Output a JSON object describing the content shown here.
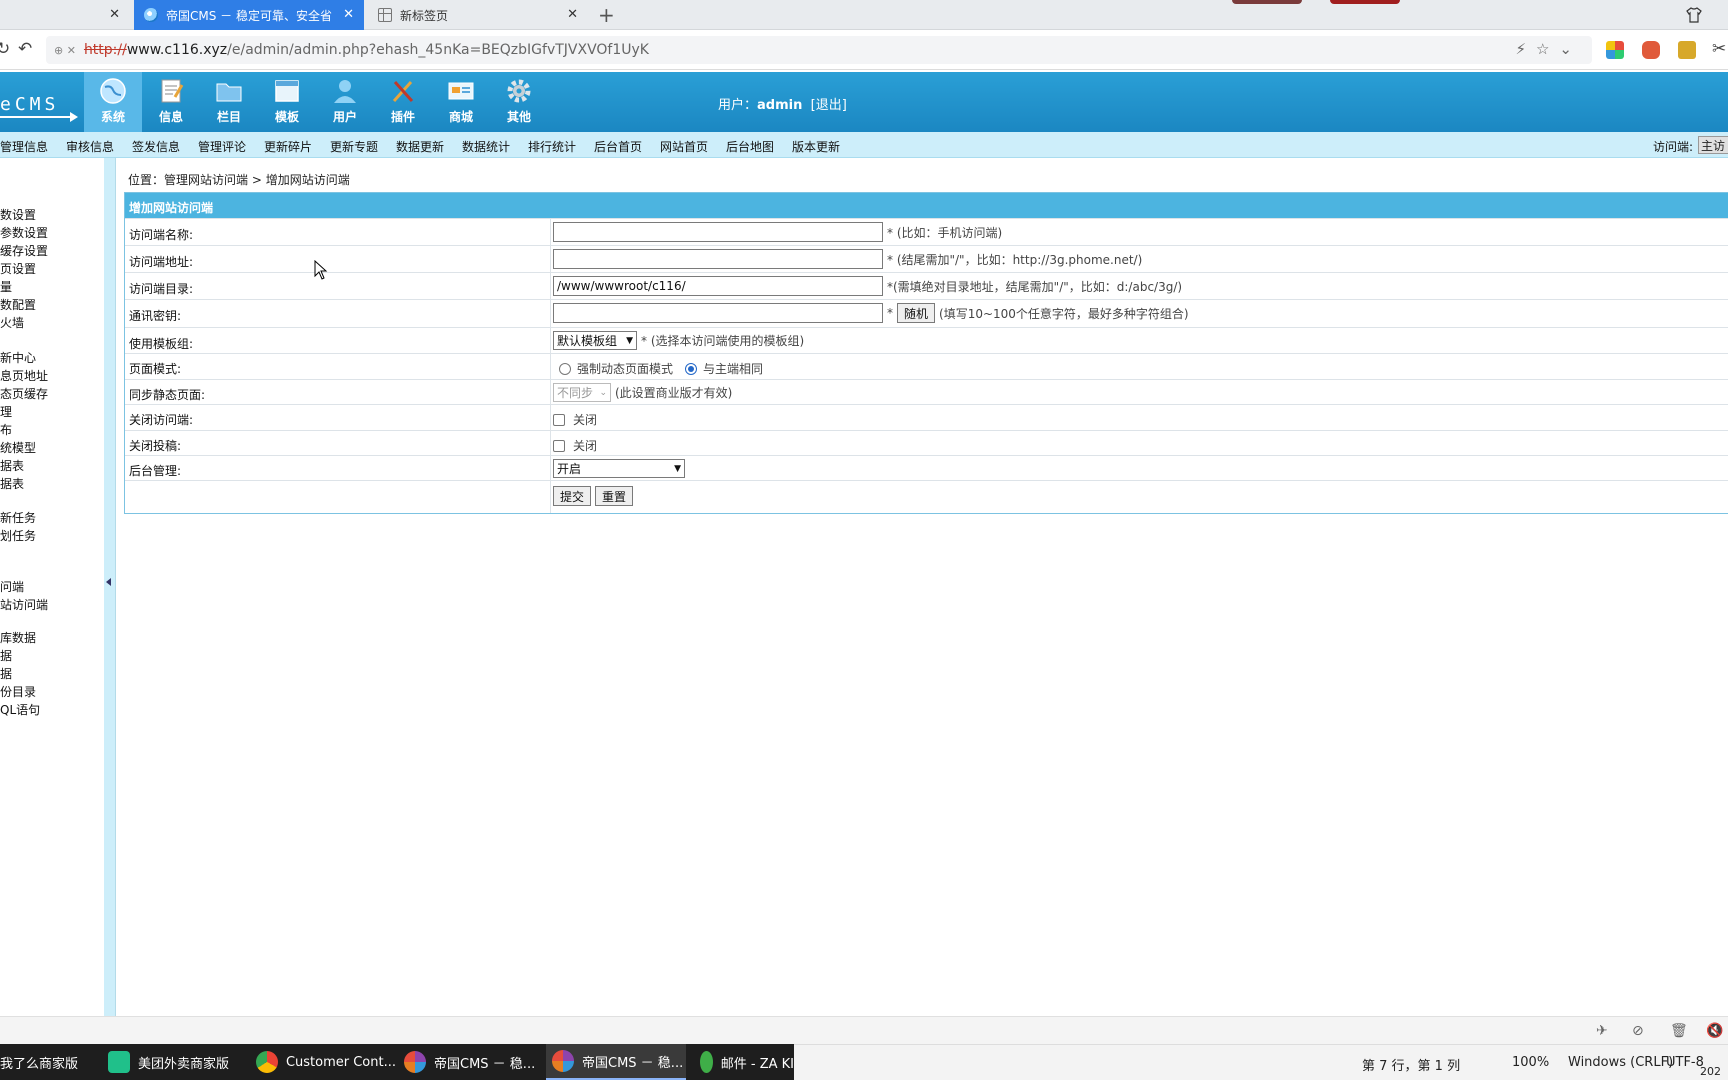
{
  "browser": {
    "tabs": [
      {
        "label": ""
      },
      {
        "label": "帝国CMS － 稳定可靠、安全省"
      },
      {
        "label": "新标签页"
      }
    ],
    "url_scheme": "http://",
    "url_host": "www.c116.xyz",
    "url_path": "/e/admin/admin.php?ehash_45nKa=BEQzbIGfvTJVXVOf1UyK"
  },
  "header": {
    "logo": "eCMS",
    "menu": [
      "系统",
      "信息",
      "栏目",
      "模板",
      "用户",
      "插件",
      "商城",
      "其他"
    ],
    "user_label": "用户：",
    "user_name": "admin",
    "logout": "[退出]"
  },
  "subnav": {
    "items": [
      "管理信息",
      "审核信息",
      "签发信息",
      "管理评论",
      "更新碎片",
      "更新专题",
      "数据更新",
      "数据统计",
      "排行统计",
      "后台首页",
      "网站首页",
      "后台地图",
      "版本更新"
    ],
    "target_label": "访问端:",
    "target_value": "主访"
  },
  "sidebar": {
    "items": [
      "数设置",
      "参数设置",
      "缓存设置",
      "页设置",
      "量",
      "数配置",
      "火墙",
      "新中心",
      "息页地址",
      "态页缓存",
      "理",
      "布",
      "统模型",
      "据表",
      "据表",
      "新任务",
      "划任务",
      "问端",
      "站访问端",
      "库数据",
      "据",
      "据",
      "份目录",
      "QL语句"
    ]
  },
  "breadcrumb": {
    "prefix": "位置：",
    "link": "管理网站访问端",
    "sep": " > ",
    "current": "增加网站访问端"
  },
  "form": {
    "title": "增加网站访问端",
    "name_label": "访问端名称:",
    "name_hint": "* (比如：手机访问端)",
    "url_label": "访问端地址:",
    "url_hint": "* (结尾需加\"/\"，比如：http://3g.phome.net/)",
    "dir_label": "访问端目录:",
    "dir_value": "/www/wwwroot/c116/",
    "dir_hint": "*(需填绝对目录地址，结尾需加\"/\"，比如：d:/abc/3g/)",
    "key_label": "通讯密钥:",
    "key_star": "*",
    "random_button": "随机",
    "key_hint": "(填写10~100个任意字符，最好多种字符组合)",
    "tpl_label": "使用模板组:",
    "tpl_value": "默认模板组",
    "tpl_hint": "* (选择本访问端使用的模板组)",
    "mode_label": "页面模式:",
    "mode_opt1": "强制动态页面模式",
    "mode_opt2": "与主端相同",
    "sync_label": "同步静态页面:",
    "sync_value": "不同步",
    "sync_hint": "(此设置商业版才有效)",
    "close_label": "关闭访问端:",
    "close_opt": "关闭",
    "post_label": "关闭投稿:",
    "post_opt": "关闭",
    "admin_label": "后台管理:",
    "admin_value": "开启",
    "submit": "提交",
    "reset": "重置"
  },
  "taskbar": {
    "items": [
      "我了么商家版",
      "美团外卖商家版",
      "Customer Cont...",
      "帝国CMS － 稳...",
      "帝国CMS － 稳...",
      "邮件 - ZA KI"
    ]
  },
  "editor_status": {
    "position": "第 7 行，第 1 列",
    "zoom": "100%",
    "eol": "Windows (CRLF)",
    "encoding": "UTF-8",
    "year": "202"
  }
}
